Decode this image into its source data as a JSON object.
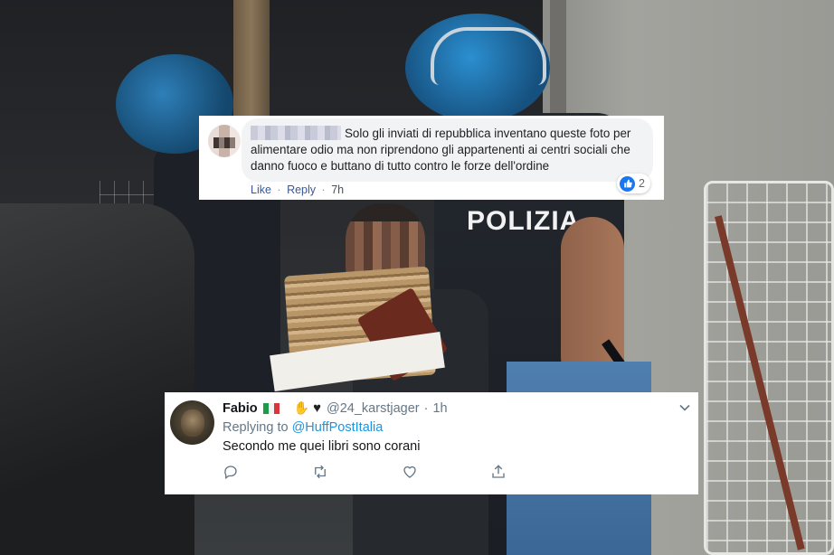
{
  "facebook_comment": {
    "text": "Solo gli inviati di repubblica inventano queste foto per alimentare odio ma non riprendono gli appartenenti ai centri sociali che danno fuoco e buttano di tutto contro le forze dell'ordine",
    "actions": {
      "like_label": "Like",
      "separator": "·",
      "reply_label": "Reply",
      "time": "7h"
    },
    "reaction_count": "2",
    "reaction_icon": "thumbs-up-icon",
    "accent_color": "#1877f2"
  },
  "tweet": {
    "display_name": "Fabio",
    "handle": "@24_karstjager",
    "separator": "·",
    "time": "1h",
    "replying_prefix": "Replying to",
    "replying_to": "@HuffPostItalia",
    "text": "Secondo me quei libri sono corani",
    "icons": [
      "italy-flag-icon",
      "raised-hand-icon",
      "black-heart-icon",
      "chevron-down-icon",
      "reply-icon",
      "retweet-icon",
      "like-icon",
      "share-icon"
    ],
    "link_color": "#1b95e0"
  },
  "photo": {
    "vest_text": "POLIZIA"
  }
}
